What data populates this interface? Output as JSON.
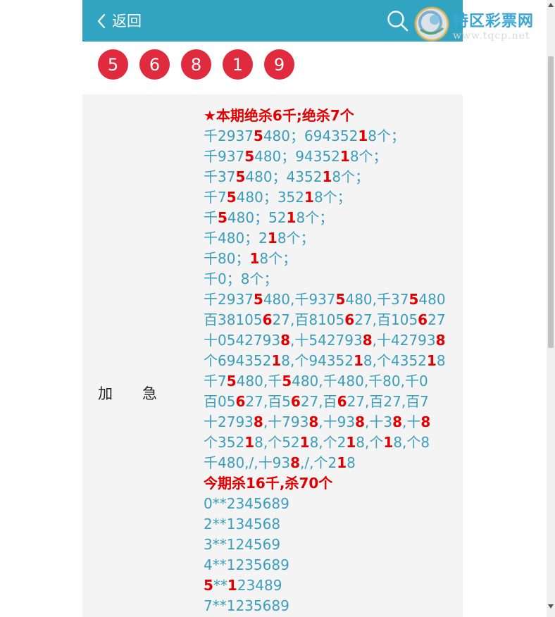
{
  "header": {
    "back_label": "返回",
    "bg_color": "#31a4c2"
  },
  "logo": {
    "title": "特区彩票网",
    "url": "www.tqcp.net"
  },
  "balls": [
    "5",
    "6",
    "8",
    "1",
    "9"
  ],
  "row": {
    "label_1": "加",
    "label_2": "急"
  },
  "lines": [
    [
      {
        "t": "★本期绝杀6千",
        "r": true
      },
      {
        "t": ";"
      },
      {
        "t": "绝杀7个",
        "r": true
      }
    ],
    [
      {
        "t": "千2937"
      },
      {
        "t": "5",
        "r": true
      },
      {
        "t": "480；694352"
      },
      {
        "t": "1",
        "r": true
      },
      {
        "t": "8个；"
      }
    ],
    [
      {
        "t": "千937"
      },
      {
        "t": "5",
        "r": true
      },
      {
        "t": "480；94352"
      },
      {
        "t": "1",
        "r": true
      },
      {
        "t": "8个；"
      }
    ],
    [
      {
        "t": "千37"
      },
      {
        "t": "5",
        "r": true
      },
      {
        "t": "480；4352"
      },
      {
        "t": "1",
        "r": true
      },
      {
        "t": "8个；"
      }
    ],
    [
      {
        "t": "千7"
      },
      {
        "t": "5",
        "r": true
      },
      {
        "t": "480；352"
      },
      {
        "t": "1",
        "r": true
      },
      {
        "t": "8个；"
      }
    ],
    [
      {
        "t": "千"
      },
      {
        "t": "5",
        "r": true
      },
      {
        "t": "480；52"
      },
      {
        "t": "1",
        "r": true
      },
      {
        "t": "8个；"
      }
    ],
    [
      {
        "t": "千480；2"
      },
      {
        "t": "1",
        "r": true
      },
      {
        "t": "8个；"
      }
    ],
    [
      {
        "t": "千80；"
      },
      {
        "t": "1",
        "r": true
      },
      {
        "t": "8个；"
      }
    ],
    [
      {
        "t": "千0；8个；"
      }
    ],
    [
      {
        "t": "千2937"
      },
      {
        "t": "5",
        "r": true
      },
      {
        "t": "480,千937"
      },
      {
        "t": "5",
        "r": true
      },
      {
        "t": "480,千37"
      },
      {
        "t": "5",
        "r": true
      },
      {
        "t": "480"
      }
    ],
    [
      {
        "t": "百38105"
      },
      {
        "t": "6",
        "r": true
      },
      {
        "t": "27,百8105"
      },
      {
        "t": "6",
        "r": true
      },
      {
        "t": "27,百105"
      },
      {
        "t": "6",
        "r": true
      },
      {
        "t": "27"
      }
    ],
    [
      {
        "t": "十054279"
      },
      {
        "t": "3",
        "r": false
      },
      {
        "t": "8",
        "r": true
      },
      {
        "t": ",十542793"
      },
      {
        "t": "8",
        "r": true
      },
      {
        "t": ",十42793"
      },
      {
        "t": "8",
        "r": true
      }
    ],
    [
      {
        "t": "个694352"
      },
      {
        "t": "1",
        "r": true
      },
      {
        "t": "8,个94352"
      },
      {
        "t": "1",
        "r": true
      },
      {
        "t": "8,个4352"
      },
      {
        "t": "1",
        "r": true
      },
      {
        "t": "8"
      }
    ],
    [
      {
        "t": "千7"
      },
      {
        "t": "5",
        "r": true
      },
      {
        "t": "480,千"
      },
      {
        "t": "5",
        "r": true
      },
      {
        "t": "480,千480,千80,千0"
      }
    ],
    [
      {
        "t": "百05"
      },
      {
        "t": "6",
        "r": true
      },
      {
        "t": "27,百5"
      },
      {
        "t": "6",
        "r": true
      },
      {
        "t": "27,百"
      },
      {
        "t": "6",
        "r": true
      },
      {
        "t": "27,百27,百7"
      }
    ],
    [
      {
        "t": "十2793"
      },
      {
        "t": "8",
        "r": true
      },
      {
        "t": ",十793"
      },
      {
        "t": "8",
        "r": true
      },
      {
        "t": ",十93"
      },
      {
        "t": "8",
        "r": true
      },
      {
        "t": ",十3"
      },
      {
        "t": "8",
        "r": true
      },
      {
        "t": ",十"
      },
      {
        "t": "8",
        "r": true
      }
    ],
    [
      {
        "t": "个352"
      },
      {
        "t": "1",
        "r": true
      },
      {
        "t": "8,个52"
      },
      {
        "t": "1",
        "r": true
      },
      {
        "t": "8,个2"
      },
      {
        "t": "1",
        "r": true
      },
      {
        "t": "8,个"
      },
      {
        "t": "1",
        "r": true
      },
      {
        "t": "8,个8"
      }
    ],
    [
      {
        "t": "千480,/,十93"
      },
      {
        "t": "8",
        "r": true
      },
      {
        "t": ",/,个2"
      },
      {
        "t": "1",
        "r": true
      },
      {
        "t": "8"
      }
    ],
    [
      {
        "t": "今期杀16千",
        "r": true
      },
      {
        "t": ","
      },
      {
        "t": "杀70个",
        "r": true
      }
    ],
    [
      {
        "t": "0**2345689"
      }
    ],
    [
      {
        "t": "2**134568"
      }
    ],
    [
      {
        "t": "3**124569"
      }
    ],
    [
      {
        "t": "4**1235689"
      }
    ],
    [
      {
        "t": "5",
        "r": true
      },
      {
        "t": "**"
      },
      {
        "t": "1",
        "r": true
      },
      {
        "t": "23489"
      }
    ],
    [
      {
        "t": "7**1235689"
      }
    ]
  ]
}
